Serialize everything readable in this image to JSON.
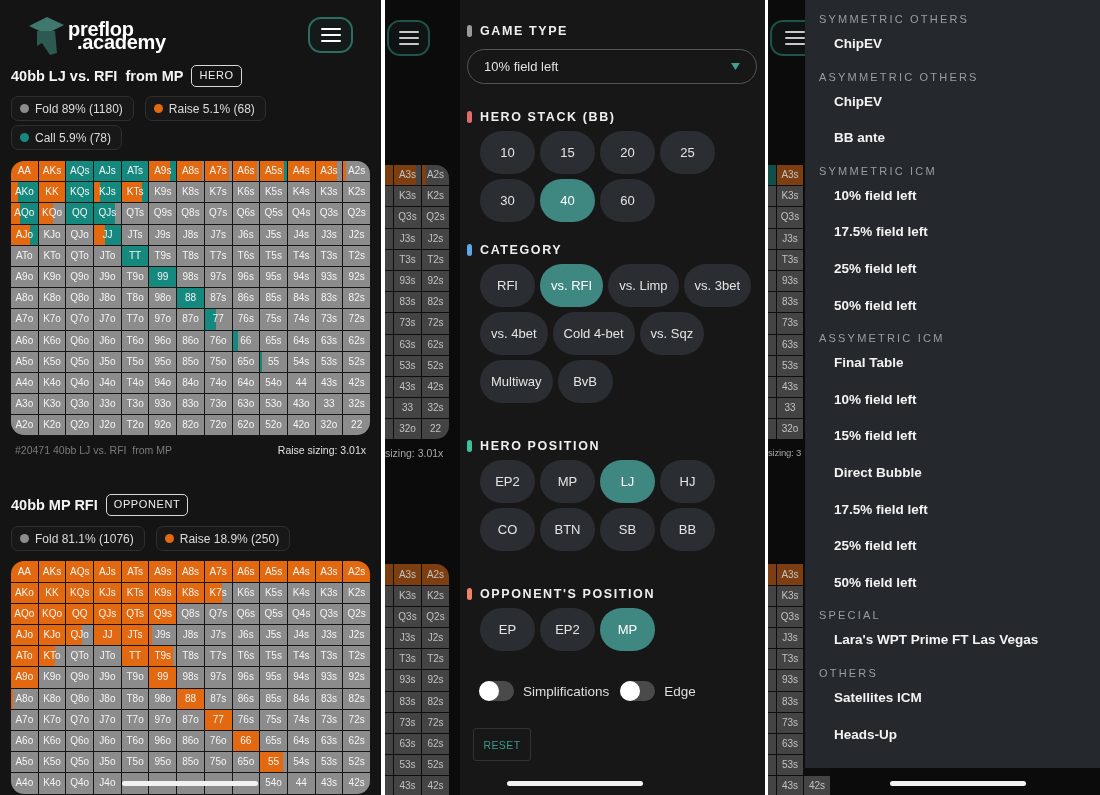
{
  "left_screen": {
    "logo": {
      "line_1": "preflop",
      "line_2": ".academy"
    },
    "ranges": [
      {
        "title": "40bb LJ vs. RFI  from MP",
        "badge": "HERO",
        "legend": [
          {
            "label": "Fold 89% (1180)",
            "color": "#8c8c8c"
          },
          {
            "label": "Raise 5.1% (68)",
            "color": "#e2690f"
          },
          {
            "label": "Call 5.9% (78)",
            "color": "#16897f"
          }
        ],
        "grid": [
          [
            {
              "hand": "AA",
              "color": "#e2690f"
            },
            {
              "hand": "AKs",
              "color": "#e2690f"
            },
            {
              "hand": "AQs",
              "color": "#16897f"
            },
            {
              "hand": "AJs",
              "color": "#16897f"
            },
            {
              "hand": "ATs",
              "color": "#16897f"
            },
            {
              "hand": "A9s",
              "color": "#16897f",
              "fill": {
                "color": "#e2690f",
                "level": 0.78
              }
            },
            {
              "hand": "A8s",
              "fill": {
                "color": "#e2690f",
                "level": 0.92
              }
            },
            {
              "hand": "A7s",
              "fill": {
                "color": "#e2690f",
                "level": 0.9
              }
            },
            {
              "hand": "A6s",
              "fill": {
                "color": "#e2690f",
                "level": 0.9
              }
            },
            {
              "hand": "A5s",
              "color": "#16897f",
              "fill": {
                "color": "#e2690f",
                "level": 0.88
              }
            },
            {
              "hand": "A4s",
              "color": "#e2690f"
            },
            {
              "hand": "A3s",
              "fill": {
                "color": "#e2690f",
                "level": 0.8
              }
            },
            {
              "hand": "A2s",
              "fill": {
                "color": "#e2690f",
                "level": 0.1
              }
            }
          ],
          [
            {
              "hand": "AKo",
              "color": "#16897f",
              "fill": {
                "color": "#e2690f",
                "level": 0.25
              }
            },
            {
              "hand": "KK",
              "color": "#e2690f"
            },
            {
              "hand": "KQs",
              "color": "#16897f"
            },
            {
              "hand": "KJs",
              "color": "#16897f",
              "fill": {
                "color": "#e2690f",
                "level": 0.22
              }
            },
            {
              "hand": "KTs",
              "color": "#16897f",
              "fill": {
                "color": "#e2690f",
                "level": 0.75
              }
            },
            {
              "hand": "K9s"
            },
            {
              "hand": "K8s"
            },
            {
              "hand": "K7s"
            },
            {
              "hand": "K6s"
            },
            {
              "hand": "K5s"
            },
            {
              "hand": "K4s"
            },
            {
              "hand": "K3s"
            },
            {
              "hand": "K2s"
            }
          ],
          [
            {
              "hand": "AQo",
              "color": "#16897f",
              "fill": {
                "color": "#e2690f",
                "level": 0.33
              }
            },
            {
              "hand": "KQo",
              "fill": {
                "color": "#e2690f",
                "level": 0.55
              }
            },
            {
              "hand": "QQ",
              "color": "#16897f"
            },
            {
              "hand": "QJs",
              "fill": {
                "color": "#16897f",
                "level": 0.8
              }
            },
            {
              "hand": "QTs"
            },
            {
              "hand": "Q9s"
            },
            {
              "hand": "Q8s"
            },
            {
              "hand": "Q7s"
            },
            {
              "hand": "Q6s"
            },
            {
              "hand": "Q5s"
            },
            {
              "hand": "Q4s"
            },
            {
              "hand": "Q3s"
            },
            {
              "hand": "Q2s"
            }
          ],
          [
            {
              "hand": "AJo",
              "color": "#16897f",
              "fill": {
                "color": "#e2690f",
                "level": 0.7
              }
            },
            {
              "hand": "KJo"
            },
            {
              "hand": "QJo"
            },
            {
              "hand": "JJ",
              "color": "#16897f",
              "fill": {
                "color": "#e2690f",
                "level": 0.4
              }
            },
            {
              "hand": "JTs"
            },
            {
              "hand": "J9s"
            },
            {
              "hand": "J8s"
            },
            {
              "hand": "J7s"
            },
            {
              "hand": "J6s"
            },
            {
              "hand": "J5s"
            },
            {
              "hand": "J4s"
            },
            {
              "hand": "J3s"
            },
            {
              "hand": "J2s"
            }
          ],
          [
            {
              "hand": "ATo"
            },
            {
              "hand": "KTo"
            },
            {
              "hand": "QTo"
            },
            {
              "hand": "JTo"
            },
            {
              "hand": "TT",
              "color": "#16897f"
            },
            {
              "hand": "T9s"
            },
            {
              "hand": "T8s"
            },
            {
              "hand": "T7s"
            },
            {
              "hand": "T6s"
            },
            {
              "hand": "T5s"
            },
            {
              "hand": "T4s"
            },
            {
              "hand": "T3s"
            },
            {
              "hand": "T2s"
            }
          ],
          [
            {
              "hand": "A9o"
            },
            {
              "hand": "K9o"
            },
            {
              "hand": "Q9o"
            },
            {
              "hand": "J9o"
            },
            {
              "hand": "T9o"
            },
            {
              "hand": "99",
              "color": "#16897f"
            },
            {
              "hand": "98s"
            },
            {
              "hand": "97s"
            },
            {
              "hand": "96s"
            },
            {
              "hand": "95s"
            },
            {
              "hand": "94s"
            },
            {
              "hand": "93s"
            },
            {
              "hand": "92s"
            }
          ],
          [
            {
              "hand": "A8o"
            },
            {
              "hand": "K8o"
            },
            {
              "hand": "Q8o"
            },
            {
              "hand": "J8o"
            },
            {
              "hand": "T8o"
            },
            {
              "hand": "98o"
            },
            {
              "hand": "88",
              "color": "#16897f"
            },
            {
              "hand": "87s"
            },
            {
              "hand": "86s"
            },
            {
              "hand": "85s"
            },
            {
              "hand": "84s"
            },
            {
              "hand": "83s"
            },
            {
              "hand": "82s"
            }
          ],
          [
            {
              "hand": "A7o"
            },
            {
              "hand": "K7o"
            },
            {
              "hand": "Q7o"
            },
            {
              "hand": "J7o"
            },
            {
              "hand": "T7o"
            },
            {
              "hand": "97o"
            },
            {
              "hand": "87o"
            },
            {
              "hand": "77",
              "fill": {
                "color": "#16897f",
                "level": 0.4
              }
            },
            {
              "hand": "76s"
            },
            {
              "hand": "75s"
            },
            {
              "hand": "74s"
            },
            {
              "hand": "73s"
            },
            {
              "hand": "72s"
            }
          ],
          [
            {
              "hand": "A6o"
            },
            {
              "hand": "K6o"
            },
            {
              "hand": "Q6o"
            },
            {
              "hand": "J6o"
            },
            {
              "hand": "T6o"
            },
            {
              "hand": "96o"
            },
            {
              "hand": "86o"
            },
            {
              "hand": "76o"
            },
            {
              "hand": "66",
              "fill": {
                "color": "#16897f",
                "level": 0.2
              }
            },
            {
              "hand": "65s"
            },
            {
              "hand": "64s"
            },
            {
              "hand": "63s"
            },
            {
              "hand": "62s"
            }
          ],
          [
            {
              "hand": "A5o"
            },
            {
              "hand": "K5o"
            },
            {
              "hand": "Q5o"
            },
            {
              "hand": "J5o"
            },
            {
              "hand": "T5o"
            },
            {
              "hand": "95o"
            },
            {
              "hand": "85o"
            },
            {
              "hand": "75o"
            },
            {
              "hand": "65o"
            },
            {
              "hand": "55",
              "fill": {
                "color": "#16897f",
                "level": 0.06
              }
            },
            {
              "hand": "54s"
            },
            {
              "hand": "53s"
            },
            {
              "hand": "52s"
            }
          ],
          [
            {
              "hand": "A4o"
            },
            {
              "hand": "K4o"
            },
            {
              "hand": "Q4o"
            },
            {
              "hand": "J4o"
            },
            {
              "hand": "T4o"
            },
            {
              "hand": "94o"
            },
            {
              "hand": "84o"
            },
            {
              "hand": "74o"
            },
            {
              "hand": "64o"
            },
            {
              "hand": "54o"
            },
            {
              "hand": "44"
            },
            {
              "hand": "43s"
            },
            {
              "hand": "42s"
            }
          ],
          [
            {
              "hand": "A3o"
            },
            {
              "hand": "K3o"
            },
            {
              "hand": "Q3o"
            },
            {
              "hand": "J3o"
            },
            {
              "hand": "T3o"
            },
            {
              "hand": "93o"
            },
            {
              "hand": "83o"
            },
            {
              "hand": "73o"
            },
            {
              "hand": "63o"
            },
            {
              "hand": "53o"
            },
            {
              "hand": "43o"
            },
            {
              "hand": "33"
            },
            {
              "hand": "32s"
            }
          ],
          [
            {
              "hand": "A2o"
            },
            {
              "hand": "K2o"
            },
            {
              "hand": "Q2o"
            },
            {
              "hand": "J2o"
            },
            {
              "hand": "T2o"
            },
            {
              "hand": "92o"
            },
            {
              "hand": "82o"
            },
            {
              "hand": "72o"
            },
            {
              "hand": "62o"
            },
            {
              "hand": "52o"
            },
            {
              "hand": "42o"
            },
            {
              "hand": "32o"
            },
            {
              "hand": "22"
            }
          ]
        ],
        "footer": {
          "caption": "#20471 40bb LJ vs. RFI  from MP",
          "sizing": "Raise sizing: 3.01x"
        }
      },
      {
        "title": "40bb MP RFI",
        "badge": "OPPONENT",
        "legend": [
          {
            "label": "Fold 81.1% (1076)",
            "color": "#8c8c8c"
          },
          {
            "label": "Raise 18.9% (250)",
            "color": "#e2690f"
          }
        ],
        "grid": [
          [
            {
              "hand": "AA",
              "color": "#e2690f"
            },
            {
              "hand": "AKs",
              "color": "#e2690f"
            },
            {
              "hand": "AQs",
              "color": "#e2690f"
            },
            {
              "hand": "AJs",
              "color": "#e2690f"
            },
            {
              "hand": "ATs",
              "color": "#e2690f"
            },
            {
              "hand": "A9s",
              "color": "#e2690f"
            },
            {
              "hand": "A8s",
              "color": "#e2690f"
            },
            {
              "hand": "A7s",
              "color": "#e2690f"
            },
            {
              "hand": "A6s",
              "color": "#e2690f"
            },
            {
              "hand": "A5s",
              "color": "#e2690f"
            },
            {
              "hand": "A4s",
              "color": "#e2690f"
            },
            {
              "hand": "A3s",
              "color": "#e2690f"
            },
            {
              "hand": "A2s",
              "color": "#e2690f"
            }
          ],
          [
            {
              "hand": "AKo",
              "color": "#e2690f"
            },
            {
              "hand": "KK",
              "color": "#e2690f"
            },
            {
              "hand": "KQs",
              "color": "#e2690f"
            },
            {
              "hand": "KJs",
              "color": "#e2690f"
            },
            {
              "hand": "KTs",
              "color": "#e2690f"
            },
            {
              "hand": "K9s",
              "color": "#e2690f"
            },
            {
              "hand": "K8s",
              "color": "#e2690f"
            },
            {
              "hand": "K7s",
              "fill": {
                "color": "#e2690f",
                "level": 0.65
              }
            },
            {
              "hand": "K6s"
            },
            {
              "hand": "K5s"
            },
            {
              "hand": "K4s"
            },
            {
              "hand": "K3s"
            },
            {
              "hand": "K2s"
            }
          ],
          [
            {
              "hand": "AQo",
              "color": "#e2690f"
            },
            {
              "hand": "KQo",
              "color": "#e2690f"
            },
            {
              "hand": "QQ",
              "color": "#e2690f"
            },
            {
              "hand": "QJs",
              "color": "#e2690f"
            },
            {
              "hand": "QTs",
              "color": "#e2690f"
            },
            {
              "hand": "Q9s",
              "color": "#e2690f"
            },
            {
              "hand": "Q8s"
            },
            {
              "hand": "Q7s"
            },
            {
              "hand": "Q6s"
            },
            {
              "hand": "Q5s"
            },
            {
              "hand": "Q4s"
            },
            {
              "hand": "Q3s"
            },
            {
              "hand": "Q2s"
            }
          ],
          [
            {
              "hand": "AJo",
              "color": "#e2690f"
            },
            {
              "hand": "KJo",
              "color": "#e2690f"
            },
            {
              "hand": "QJo",
              "fill": {
                "color": "#e2690f",
                "level": 0.6
              }
            },
            {
              "hand": "JJ",
              "color": "#e2690f"
            },
            {
              "hand": "JTs",
              "color": "#e2690f"
            },
            {
              "hand": "J9s",
              "fill": {
                "color": "#e2690f",
                "level": 0.08
              }
            },
            {
              "hand": "J8s"
            },
            {
              "hand": "J7s"
            },
            {
              "hand": "J6s"
            },
            {
              "hand": "J5s"
            },
            {
              "hand": "J4s"
            },
            {
              "hand": "J3s"
            },
            {
              "hand": "J2s"
            }
          ],
          [
            {
              "hand": "ATo",
              "color": "#e2690f"
            },
            {
              "hand": "KTo",
              "fill": {
                "color": "#e2690f",
                "level": 0.6
              }
            },
            {
              "hand": "QTo"
            },
            {
              "hand": "JTo"
            },
            {
              "hand": "TT",
              "color": "#e2690f"
            },
            {
              "hand": "T9s",
              "fill": {
                "color": "#e2690f",
                "level": 0.9
              }
            },
            {
              "hand": "T8s"
            },
            {
              "hand": "T7s"
            },
            {
              "hand": "T6s"
            },
            {
              "hand": "T5s"
            },
            {
              "hand": "T4s"
            },
            {
              "hand": "T3s"
            },
            {
              "hand": "T2s"
            }
          ],
          [
            {
              "hand": "A9o",
              "color": "#e2690f"
            },
            {
              "hand": "K9o"
            },
            {
              "hand": "Q9o"
            },
            {
              "hand": "J9o"
            },
            {
              "hand": "T9o"
            },
            {
              "hand": "99",
              "color": "#e2690f"
            },
            {
              "hand": "98s"
            },
            {
              "hand": "97s"
            },
            {
              "hand": "96s"
            },
            {
              "hand": "95s"
            },
            {
              "hand": "94s"
            },
            {
              "hand": "93s"
            },
            {
              "hand": "92s"
            }
          ],
          [
            {
              "hand": "A8o",
              "fill": {
                "color": "#e2690f",
                "level": 0.08
              }
            },
            {
              "hand": "K8o"
            },
            {
              "hand": "Q8o"
            },
            {
              "hand": "J8o"
            },
            {
              "hand": "T8o"
            },
            {
              "hand": "98o"
            },
            {
              "hand": "88",
              "color": "#e2690f"
            },
            {
              "hand": "87s"
            },
            {
              "hand": "86s"
            },
            {
              "hand": "85s"
            },
            {
              "hand": "84s"
            },
            {
              "hand": "83s"
            },
            {
              "hand": "82s"
            }
          ],
          [
            {
              "hand": "A7o"
            },
            {
              "hand": "K7o"
            },
            {
              "hand": "Q7o"
            },
            {
              "hand": "J7o"
            },
            {
              "hand": "T7o"
            },
            {
              "hand": "97o"
            },
            {
              "hand": "87o"
            },
            {
              "hand": "77",
              "color": "#e2690f"
            },
            {
              "hand": "76s"
            },
            {
              "hand": "75s"
            },
            {
              "hand": "74s"
            },
            {
              "hand": "73s"
            },
            {
              "hand": "72s"
            }
          ],
          [
            {
              "hand": "A6o"
            },
            {
              "hand": "K6o"
            },
            {
              "hand": "Q6o"
            },
            {
              "hand": "J6o"
            },
            {
              "hand": "T6o"
            },
            {
              "hand": "96o"
            },
            {
              "hand": "86o"
            },
            {
              "hand": "76o"
            },
            {
              "hand": "66",
              "color": "#e2690f"
            },
            {
              "hand": "65s"
            },
            {
              "hand": "64s"
            },
            {
              "hand": "63s"
            },
            {
              "hand": "62s"
            }
          ],
          [
            {
              "hand": "A5o"
            },
            {
              "hand": "K5o"
            },
            {
              "hand": "Q5o"
            },
            {
              "hand": "J5o"
            },
            {
              "hand": "T5o"
            },
            {
              "hand": "95o"
            },
            {
              "hand": "85o"
            },
            {
              "hand": "75o"
            },
            {
              "hand": "65o"
            },
            {
              "hand": "55",
              "fill": {
                "color": "#e2690f",
                "level": 0.85
              }
            },
            {
              "hand": "54s"
            },
            {
              "hand": "53s"
            },
            {
              "hand": "52s"
            }
          ],
          [
            {
              "hand": "A4o"
            },
            {
              "hand": "K4o"
            },
            {
              "hand": "Q4o"
            },
            {
              "hand": "J4o"
            },
            {
              "kind": "covered"
            },
            {
              "kind": "covered"
            },
            {
              "kind": "covered"
            },
            {
              "kind": "covered"
            },
            {
              "kind": "covered"
            },
            {
              "hand": "54o"
            },
            {
              "hand": "44"
            },
            {
              "hand": "43s"
            },
            {
              "hand": "42s"
            }
          ]
        ]
      }
    ]
  },
  "middle_screen": {
    "backdrop": {
      "grid_top": [
        [
          {
            "kind": "edge",
            "color": "#7d3f12"
          },
          {
            "kind": "hand",
            "hand": "A3s",
            "fill": {
              "color": "#7d3f12",
              "level": 0.8
            }
          },
          {
            "kind": "hand",
            "hand": "A2s",
            "fill": {
              "color": "#7d3f12",
              "level": 0.15
            }
          }
        ],
        [
          {
            "kind": "edge"
          },
          {
            "kind": "hand",
            "hand": "K3s"
          },
          {
            "kind": "hand",
            "hand": "K2s"
          }
        ],
        [
          {
            "kind": "edge"
          },
          {
            "kind": "hand",
            "hand": "Q3s"
          },
          {
            "kind": "hand",
            "hand": "Q2s"
          }
        ],
        [
          {
            "kind": "edge"
          },
          {
            "kind": "hand",
            "hand": "J3s"
          },
          {
            "kind": "hand",
            "hand": "J2s"
          }
        ],
        [
          {
            "kind": "edge"
          },
          {
            "kind": "hand",
            "hand": "T3s"
          },
          {
            "kind": "hand",
            "hand": "T2s"
          }
        ],
        [
          {
            "kind": "edge"
          },
          {
            "kind": "hand",
            "hand": "93s"
          },
          {
            "kind": "hand",
            "hand": "92s"
          }
        ],
        [
          {
            "kind": "edge"
          },
          {
            "kind": "hand",
            "hand": "83s"
          },
          {
            "kind": "hand",
            "hand": "82s"
          }
        ],
        [
          {
            "kind": "edge"
          },
          {
            "kind": "hand",
            "hand": "73s"
          },
          {
            "kind": "hand",
            "hand": "72s"
          }
        ],
        [
          {
            "kind": "edge"
          },
          {
            "kind": "hand",
            "hand": "63s"
          },
          {
            "kind": "hand",
            "hand": "62s"
          }
        ],
        [
          {
            "kind": "edge"
          },
          {
            "kind": "hand",
            "hand": "53s"
          },
          {
            "kind": "hand",
            "hand": "52s"
          }
        ],
        [
          {
            "kind": "edge"
          },
          {
            "kind": "hand",
            "hand": "43s"
          },
          {
            "kind": "hand",
            "hand": "42s"
          }
        ],
        [
          {
            "kind": "edge"
          },
          {
            "kind": "hand",
            "hand": "33"
          },
          {
            "kind": "hand",
            "hand": "32s"
          }
        ],
        [
          {
            "kind": "edge"
          },
          {
            "kind": "hand",
            "hand": "32o"
          },
          {
            "kind": "hand",
            "hand": "22"
          }
        ]
      ],
      "sizing": "sizing: 3.01x",
      "grid_bottom": [
        [
          {
            "kind": "edge",
            "color": "#7d3f12"
          },
          {
            "kind": "hand",
            "hand": "A3s",
            "color": "#7d3f12"
          },
          {
            "kind": "hand",
            "hand": "A2s",
            "color": "#7d3f12"
          }
        ],
        [
          {
            "kind": "edge"
          },
          {
            "kind": "hand",
            "hand": "K3s"
          },
          {
            "kind": "hand",
            "hand": "K2s"
          }
        ],
        [
          {
            "kind": "edge"
          },
          {
            "kind": "hand",
            "hand": "Q3s"
          },
          {
            "kind": "hand",
            "hand": "Q2s"
          }
        ],
        [
          {
            "kind": "edge"
          },
          {
            "kind": "hand",
            "hand": "J3s"
          },
          {
            "kind": "hand",
            "hand": "J2s"
          }
        ],
        [
          {
            "kind": "edge"
          },
          {
            "kind": "hand",
            "hand": "T3s"
          },
          {
            "kind": "hand",
            "hand": "T2s"
          }
        ],
        [
          {
            "kind": "edge"
          },
          {
            "kind": "hand",
            "hand": "93s"
          },
          {
            "kind": "hand",
            "hand": "92s"
          }
        ],
        [
          {
            "kind": "edge"
          },
          {
            "kind": "hand",
            "hand": "83s"
          },
          {
            "kind": "hand",
            "hand": "82s"
          }
        ],
        [
          {
            "kind": "edge"
          },
          {
            "kind": "hand",
            "hand": "73s"
          },
          {
            "kind": "hand",
            "hand": "72s"
          }
        ],
        [
          {
            "kind": "edge"
          },
          {
            "kind": "hand",
            "hand": "63s"
          },
          {
            "kind": "hand",
            "hand": "62s"
          }
        ],
        [
          {
            "kind": "edge"
          },
          {
            "kind": "hand",
            "hand": "53s"
          },
          {
            "kind": "hand",
            "hand": "52s"
          }
        ],
        [
          {
            "kind": "edge"
          },
          {
            "kind": "hand",
            "hand": "43s"
          },
          {
            "kind": "hand",
            "hand": "42s"
          }
        ]
      ]
    },
    "drawer": {
      "sections": [
        {
          "kind": "select",
          "heading": "GAME TYPE",
          "color": "#9b9b9b",
          "value": "10% field left"
        },
        {
          "kind": "chips",
          "heading": "HERO STACK (BB)",
          "color": "#e46b6b",
          "options": [
            {
              "label": "10",
              "selected": false
            },
            {
              "label": "15",
              "selected": false
            },
            {
              "label": "20",
              "selected": false
            },
            {
              "label": "25",
              "selected": false
            },
            {
              "label": "30",
              "selected": false
            },
            {
              "label": "40",
              "selected": true
            },
            {
              "label": "60",
              "selected": false
            }
          ]
        },
        {
          "kind": "chips",
          "heading": "CATEGORY",
          "color": "#5ea8e8",
          "options": [
            {
              "label": "RFI",
              "selected": false
            },
            {
              "label": "vs. RFI",
              "selected": true
            },
            {
              "label": "vs. Limp",
              "selected": false
            },
            {
              "label": "vs. 3bet",
              "selected": false
            },
            {
              "label": "vs. 4bet",
              "selected": false
            },
            {
              "label": "Cold 4-bet",
              "selected": false
            },
            {
              "label": "vs. Sqz",
              "selected": false
            },
            {
              "label": "Multiway",
              "selected": false
            },
            {
              "label": "BvB",
              "selected": false
            }
          ]
        },
        {
          "kind": "chips",
          "heading": "HERO POSITION",
          "color": "#3fbf9f",
          "options": [
            {
              "label": "EP2",
              "selected": false
            },
            {
              "label": "MP",
              "selected": false
            },
            {
              "label": "LJ",
              "selected": true
            },
            {
              "label": "HJ",
              "selected": false
            },
            {
              "label": "CO",
              "selected": false
            },
            {
              "label": "BTN",
              "selected": false
            },
            {
              "label": "SB",
              "selected": false
            },
            {
              "label": "BB",
              "selected": false
            }
          ]
        },
        {
          "kind": "chips",
          "heading": "OPPONENT'S POSITION",
          "color": "#ef8366",
          "options": [
            {
              "label": "EP",
              "selected": false
            },
            {
              "label": "EP2",
              "selected": false
            },
            {
              "label": "MP",
              "selected": true
            }
          ]
        }
      ],
      "toggles": [
        {
          "label": "Simplifications",
          "on": false
        },
        {
          "label": "Edge",
          "on": false
        }
      ],
      "reset": "RESET"
    }
  },
  "right_screen": {
    "backdrop": {
      "grid_top": [
        [
          {
            "kind": "edge",
            "color": "#10504a"
          },
          {
            "kind": "hand",
            "hand": "A3s",
            "color": "#7d3f12"
          }
        ],
        [
          {
            "kind": "edge"
          },
          {
            "kind": "hand",
            "hand": "K3s"
          }
        ],
        [
          {
            "kind": "edge"
          },
          {
            "kind": "hand",
            "hand": "Q3s"
          }
        ],
        [
          {
            "kind": "edge"
          },
          {
            "kind": "hand",
            "hand": "J3s"
          }
        ],
        [
          {
            "kind": "edge"
          },
          {
            "kind": "hand",
            "hand": "T3s"
          }
        ],
        [
          {
            "kind": "edge"
          },
          {
            "kind": "hand",
            "hand": "93s"
          }
        ],
        [
          {
            "kind": "edge"
          },
          {
            "kind": "hand",
            "hand": "83s"
          }
        ],
        [
          {
            "kind": "edge"
          },
          {
            "kind": "hand",
            "hand": "73s"
          }
        ],
        [
          {
            "kind": "edge"
          },
          {
            "kind": "hand",
            "hand": "63s"
          }
        ],
        [
          {
            "kind": "edge"
          },
          {
            "kind": "hand",
            "hand": "53s"
          }
        ],
        [
          {
            "kind": "edge"
          },
          {
            "kind": "hand",
            "hand": "43s"
          }
        ],
        [
          {
            "kind": "edge"
          },
          {
            "kind": "hand",
            "hand": "33"
          }
        ],
        [
          {
            "kind": "edge"
          },
          {
            "kind": "hand",
            "hand": "32o"
          }
        ]
      ],
      "sizing": "sizing: 3",
      "grid_bottom": [
        [
          {
            "kind": "edge",
            "color": "#7d3f12"
          },
          {
            "kind": "hand",
            "hand": "A3s",
            "color": "#7d3f12"
          }
        ],
        [
          {
            "kind": "edge"
          },
          {
            "kind": "hand",
            "hand": "K3s"
          }
        ],
        [
          {
            "kind": "edge"
          },
          {
            "kind": "hand",
            "hand": "Q3s"
          }
        ],
        [
          {
            "kind": "edge"
          },
          {
            "kind": "hand",
            "hand": "J3s"
          }
        ],
        [
          {
            "kind": "edge"
          },
          {
            "kind": "hand",
            "hand": "T3s"
          }
        ],
        [
          {
            "kind": "edge"
          },
          {
            "kind": "hand",
            "hand": "93s"
          }
        ],
        [
          {
            "kind": "edge"
          },
          {
            "kind": "hand",
            "hand": "83s"
          }
        ],
        [
          {
            "kind": "edge"
          },
          {
            "kind": "hand",
            "hand": "73s"
          }
        ],
        [
          {
            "kind": "edge"
          },
          {
            "kind": "hand",
            "hand": "63s"
          }
        ],
        [
          {
            "kind": "edge"
          },
          {
            "kind": "hand",
            "hand": "53s"
          }
        ],
        [
          {
            "kind": "edge"
          },
          {
            "kind": "hand",
            "hand": "43s"
          },
          {
            "kind": "hand",
            "hand": "42s"
          }
        ]
      ]
    },
    "menu": [
      {
        "heading": "SYMMETRIC OTHERS",
        "items": [
          "ChipEV"
        ]
      },
      {
        "heading": "ASYMMETRIC OTHERS",
        "items": [
          "ChipEV",
          "BB ante"
        ]
      },
      {
        "heading": "SYMMETRIC ICM",
        "items": [
          "10% field left",
          "17.5% field left",
          "25% field left",
          "50% field left"
        ]
      },
      {
        "heading": "ASSYMETRIC ICM",
        "items": [
          "Final Table",
          "10% field left",
          "15% field left",
          "Direct Bubble",
          "17.5% field left",
          "25% field left",
          "50% field left"
        ]
      },
      {
        "heading": "SPECIAL",
        "items": [
          "Lara's WPT Prime FT Las Vegas"
        ]
      },
      {
        "heading": "OTHERS",
        "items": [
          "Satellites ICM",
          "Heads-Up"
        ]
      }
    ]
  }
}
